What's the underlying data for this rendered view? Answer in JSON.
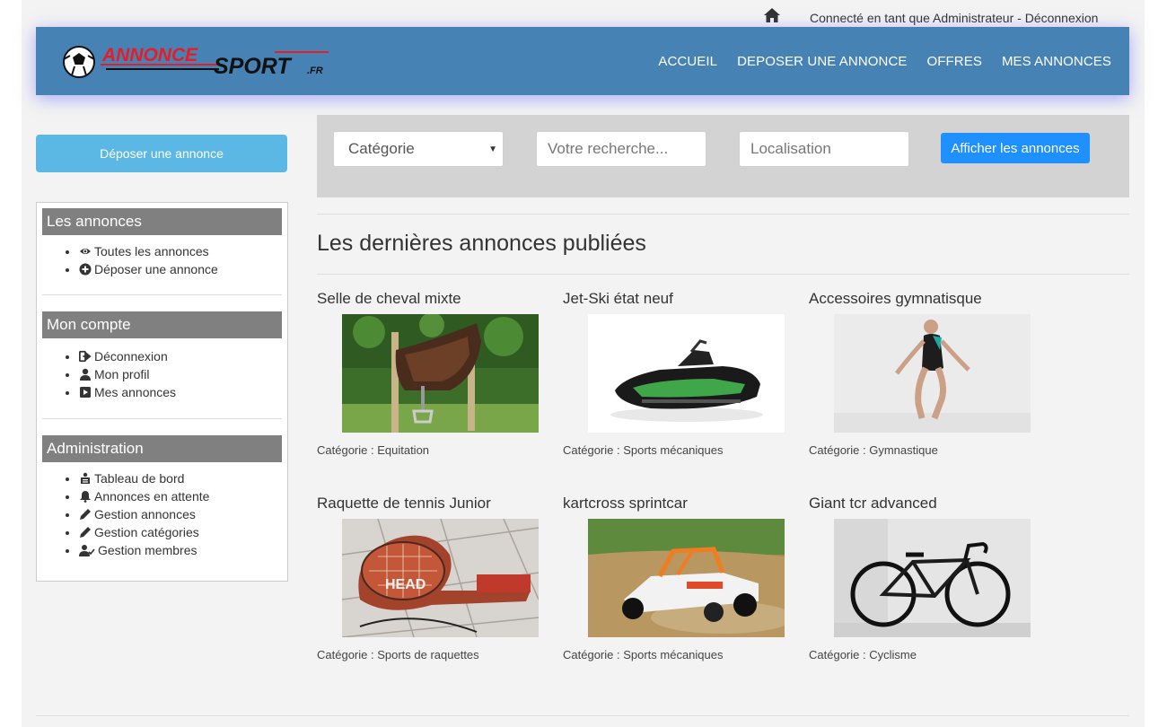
{
  "topbar": {
    "status_text": "Connecté en tant que Administrateur - ",
    "logout_link": "Déconnexion",
    "home_icon": "home-icon"
  },
  "brand": {
    "logo_word1": "ANNONCE",
    "logo_word2": "SPORT",
    "logo_suffix": ".FR",
    "accent_color": "#e81c24",
    "navbar_color": "#4682b4"
  },
  "nav": {
    "items": [
      "ACCUEIL",
      "DEPOSER UNE ANNONCE",
      "OFFRES",
      "MES ANNONCES"
    ]
  },
  "sidebar": {
    "deposit_button": "Déposer une annonce",
    "sections": [
      {
        "title": "Les annonces",
        "items": [
          {
            "label": "Toutes les annonces",
            "icon": "eye-icon"
          },
          {
            "label": "Déposer une annonce",
            "icon": "plus-circle-icon"
          }
        ]
      },
      {
        "title": "Mon compte",
        "items": [
          {
            "label": "Déconnexion",
            "icon": "logout-icon"
          },
          {
            "label": "Mon profil",
            "icon": "user-icon"
          },
          {
            "label": "Mes annonces",
            "icon": "play-square-icon"
          }
        ]
      },
      {
        "title": "Administration",
        "items": [
          {
            "label": "Tableau de bord",
            "icon": "dashboard-icon"
          },
          {
            "label": "Annonces en attente",
            "icon": "bell-icon"
          },
          {
            "label": "Gestion annonces",
            "icon": "pencil-icon"
          },
          {
            "label": "Gestion catégories",
            "icon": "pencil-icon"
          },
          {
            "label": "Gestion membres",
            "icon": "user-check-icon"
          }
        ]
      }
    ]
  },
  "search": {
    "category_selected": "Catégorie",
    "query_placeholder": "Votre recherche...",
    "location_placeholder": "Localisation",
    "submit_label": "Afficher les annonces"
  },
  "listing": {
    "heading": "Les dernières annonces publiées",
    "category_prefix": "Catégorie : ",
    "items": [
      {
        "title": "Selle de cheval mixte",
        "category": "Equitation",
        "image": "saddle-photo"
      },
      {
        "title": "Jet-Ski état neuf",
        "category": "Sports mécaniques",
        "image": "jetski-photo"
      },
      {
        "title": "Accessoires gymnatisque",
        "category": "Gymnastique",
        "image": "gymnast-photo"
      },
      {
        "title": "Raquette de tennis Junior",
        "category": "Sports de raquettes",
        "image": "tennis-racket-photo"
      },
      {
        "title": "kartcross sprintcar",
        "category": "Sports mécaniques",
        "image": "kartcross-photo"
      },
      {
        "title": "Giant tcr advanced",
        "category": "Cyclisme",
        "image": "road-bike-photo"
      }
    ]
  }
}
